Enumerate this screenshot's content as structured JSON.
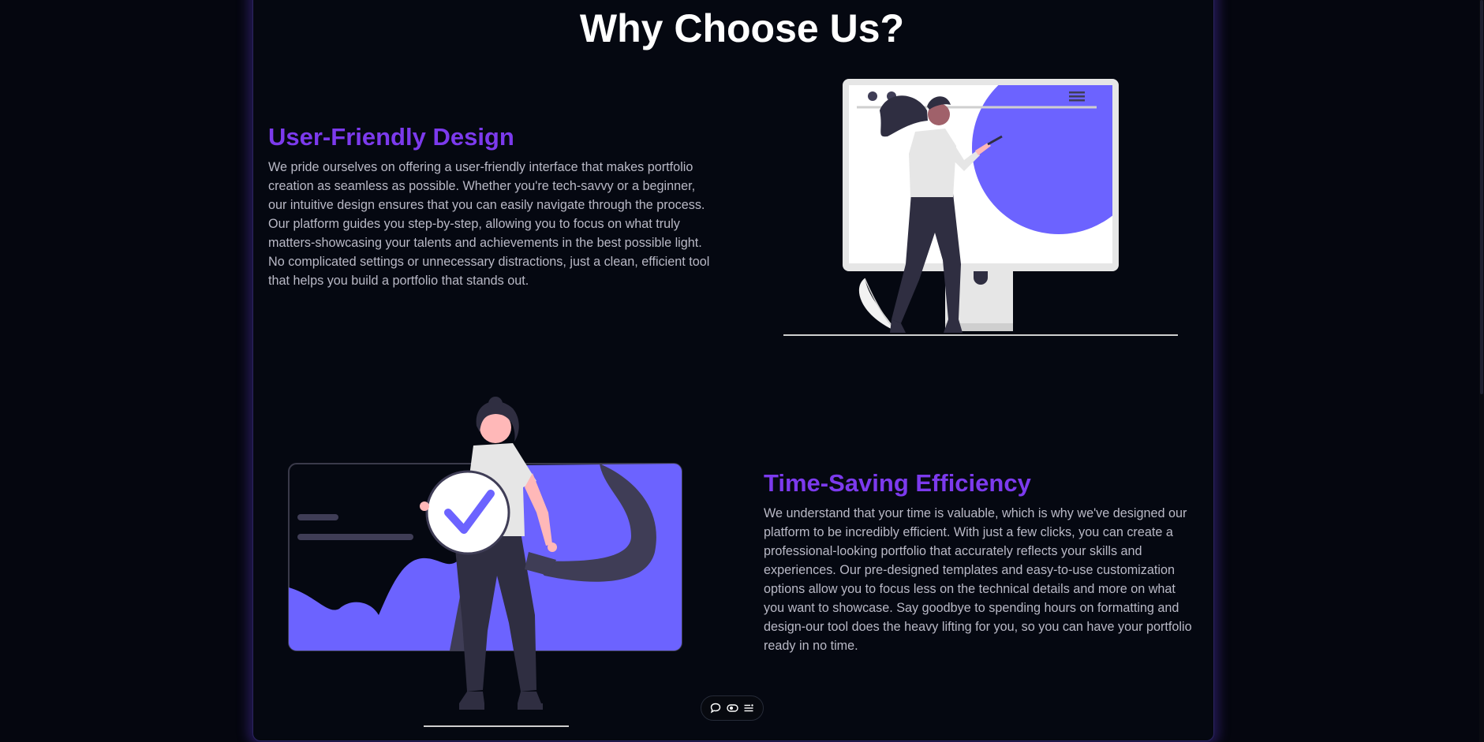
{
  "page": {
    "title": "Why Choose Us?"
  },
  "features": [
    {
      "title": "User-Friendly Design",
      "text": "We pride ourselves on offering a user-friendly interface that makes portfolio creation as seamless as possible. Whether you're tech-savvy or a beginner, our intuitive design ensures that you can easily navigate through the process. Our platform guides you step-by-step, allowing you to focus on what truly matters-showcasing your talents and achievements in the best possible light. No complicated settings or unnecessary distractions, just a clean, efficient tool that helps you build a portfolio that stands out.",
      "illustration": "woman-painting-monitor-illustration"
    },
    {
      "title": "Time-Saving Efficiency",
      "text": "We understand that your time is valuable, which is why we've designed our platform to be incredibly efficient. With just a few clicks, you can create a professional-looking portfolio that accurately reflects your skills and experiences. Our pre-designed templates and easy-to-use customization options allow you to focus less on the technical details and more on what you want to showcase. Say goodbye to spending hours on formatting and design-our tool does the heavy lifting for you, so you can have your portfolio ready in no time.",
      "illustration": "woman-holding-checkmark-illustration"
    }
  ],
  "toolbar": {
    "icons": [
      "chat-bubble-icon",
      "eye-toggle-icon",
      "menu-list-icon"
    ]
  },
  "colors": {
    "background": "#05060f",
    "accent": "#7c3aed",
    "illustration_purple": "#6c63ff",
    "text": "#b9b9c6",
    "heading": "#ffffff"
  }
}
